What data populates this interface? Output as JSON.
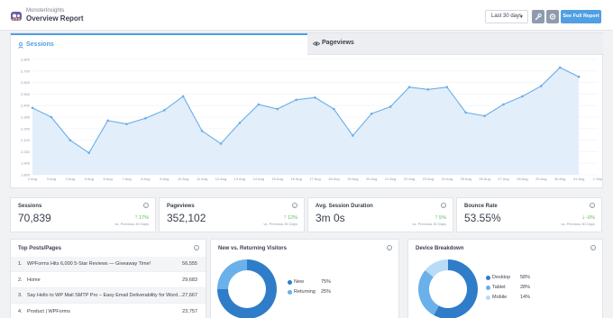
{
  "header": {
    "brand": "MonsterInsights",
    "title": "Overview Report",
    "date_range": "Last 30 days",
    "full_report": "See Full Report"
  },
  "tabs": [
    {
      "label": "Sessions",
      "active": true
    },
    {
      "label": "Pageviews",
      "active": false
    }
  ],
  "chart_data": {
    "type": "area",
    "series": [
      {
        "name": "Sessions",
        "values": [
          2380,
          2300,
          2100,
          1990,
          2270,
          2240,
          2290,
          2360,
          2480,
          2180,
          2070,
          2250,
          2410,
          2370,
          2450,
          2470,
          2370,
          2140,
          2330,
          2390,
          2560,
          2540,
          2560,
          2340,
          2310,
          2410,
          2480,
          2570,
          2730,
          2650
        ]
      }
    ],
    "x": [
      "2 Aug",
      "3 Aug",
      "4 Aug",
      "5 Aug",
      "6 Aug",
      "7 Aug",
      "8 Aug",
      "9 Aug",
      "10 Aug",
      "11 Aug",
      "12 Aug",
      "13 Aug",
      "14 Aug",
      "15 Aug",
      "16 Aug",
      "17 Aug",
      "18 Aug",
      "19 Aug",
      "20 Aug",
      "21 Aug",
      "22 Aug",
      "23 Aug",
      "24 Aug",
      "25 Aug",
      "26 Aug",
      "27 Aug",
      "28 Aug",
      "29 Aug",
      "30 Aug",
      "31 Aug",
      "1 Sep"
    ],
    "y_ticks": [
      "1,800",
      "1,900",
      "2,000",
      "2,100",
      "2,200",
      "2,300",
      "2,400",
      "2,500",
      "2,600",
      "2,700",
      "2,800"
    ],
    "ylim": [
      1800,
      2800
    ],
    "grid": true,
    "colors": {
      "line": "#6aaee6",
      "fill": "#e3eefb"
    }
  },
  "stats": [
    {
      "label": "Sessions",
      "value": "70,839",
      "change": "17%",
      "direction": "up",
      "prev": "vs. Previous 30 Days"
    },
    {
      "label": "Pageviews",
      "value": "352,102",
      "change": "12%",
      "direction": "up",
      "prev": "vs. Previous 30 Days"
    },
    {
      "label": "Avg. Session Duration",
      "value": "3m 0s",
      "change": "5%",
      "direction": "up",
      "prev": "vs. Previous 30 Days"
    },
    {
      "label": "Bounce Rate",
      "value": "53.55%",
      "change": "-0%",
      "direction": "down",
      "prev": "vs. Previous 30 Days"
    }
  ],
  "top_posts": {
    "title": "Top Posts/Pages",
    "rows": [
      {
        "n": "1.",
        "title": "WPForms Hits 6,000 5-Star Reviews — Giveaway Time!",
        "count": "56,555"
      },
      {
        "n": "2.",
        "title": "Home",
        "count": "29,683"
      },
      {
        "n": "3.",
        "title": "Say Hello to WP Mail SMTP Pro – Easy Email Deliverability for WordPress",
        "count": "27,667"
      },
      {
        "n": "4.",
        "title": "Product | WPForms",
        "count": "23,757"
      }
    ]
  },
  "new_returning": {
    "title": "New vs. Returning Visitors",
    "items": [
      {
        "label": "New",
        "value": "75%",
        "fraction": 0.75,
        "color": "#2f7dc8"
      },
      {
        "label": "Returning",
        "value": "25%",
        "fraction": 0.25,
        "color": "#6ab0ea"
      }
    ]
  },
  "device": {
    "title": "Device Breakdown",
    "items": [
      {
        "label": "Desktop",
        "value": "58%",
        "fraction": 0.58,
        "color": "#2f7dc8"
      },
      {
        "label": "Tablet",
        "value": "28%",
        "fraction": 0.28,
        "color": "#6ab0ea"
      },
      {
        "label": "Mobile",
        "value": "14%",
        "fraction": 0.14,
        "color": "#b8dbf7"
      }
    ]
  }
}
